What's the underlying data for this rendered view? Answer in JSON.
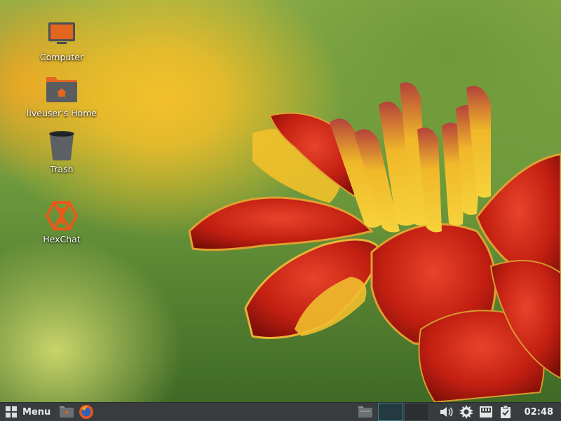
{
  "desktop": {
    "icons": [
      {
        "label": "Computer"
      },
      {
        "label": "liveuser's Home"
      },
      {
        "label": "Trash"
      },
      {
        "label": "HexChat"
      }
    ]
  },
  "panel": {
    "menu_label": "Menu",
    "clock": "02:48",
    "launchers": [
      "file-manager-icon",
      "firefox-icon"
    ],
    "tray": [
      "volume-icon",
      "settings-icon",
      "network-icon",
      "clipboard-icon"
    ],
    "workspaces": {
      "count": 2,
      "active_index": 0
    }
  },
  "colors": {
    "panel_bg": "#383c3e",
    "accent": "#e8602c",
    "workspace_active": "#3e7f8f"
  }
}
